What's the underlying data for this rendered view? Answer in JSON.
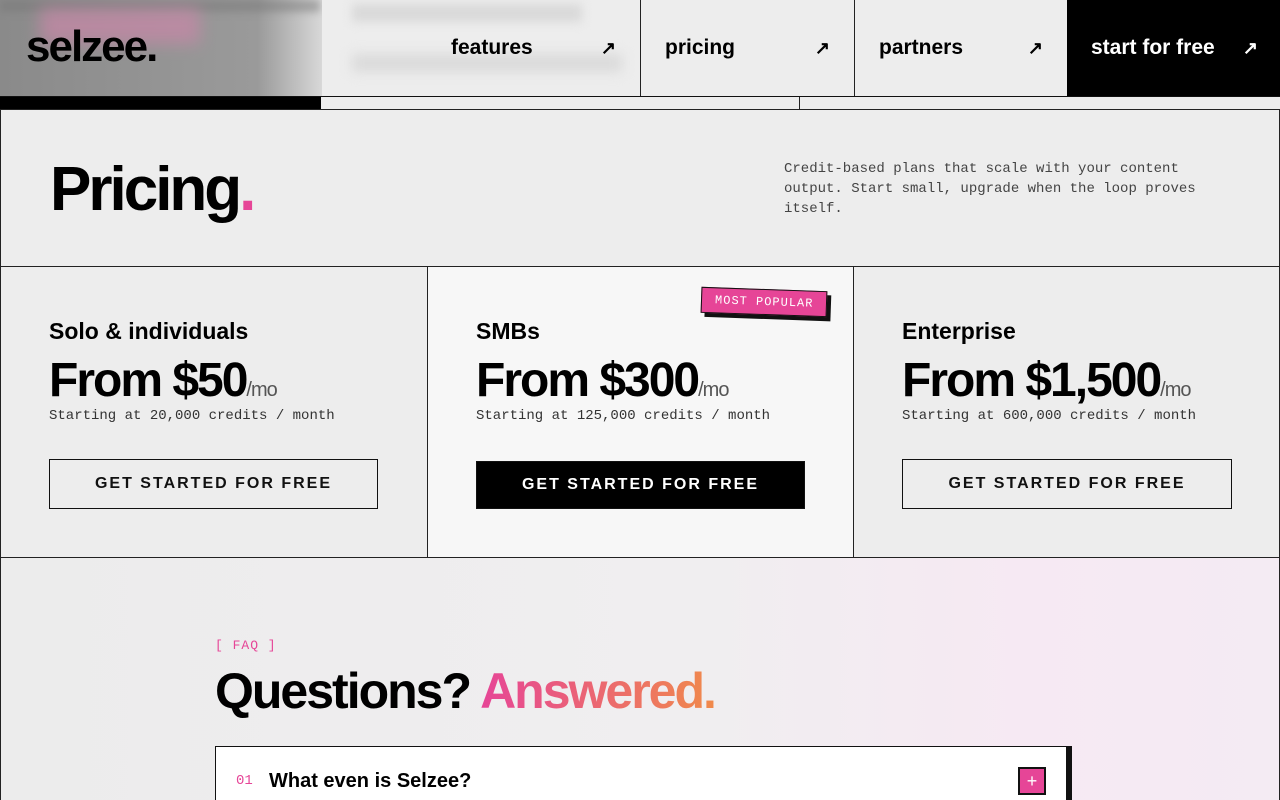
{
  "nav": {
    "logo": "selzee.",
    "items": [
      {
        "label": "features",
        "icon": "arrow-up-right-icon"
      },
      {
        "label": "pricing",
        "icon": "arrow-up-right-icon"
      },
      {
        "label": "partners",
        "icon": "arrow-up-right-icon"
      }
    ],
    "cta": "start for free"
  },
  "pricing": {
    "title": "Pricing",
    "title_dot": ".",
    "description": "Credit-based plans that scale with your content output. Start small, upgrade when the loop proves itself."
  },
  "badge": "MOST POPULAR",
  "plans": [
    {
      "name": "Solo & individuals",
      "price": "From $50",
      "unit": "/mo",
      "credits": "Starting at 20,000 credits / month",
      "button": "GET STARTED FOR FREE"
    },
    {
      "name": "SMBs",
      "price": "From $300",
      "unit": "/mo",
      "credits": "Starting at 125,000 credits / month",
      "button": "GET STARTED FOR FREE"
    },
    {
      "name": "Enterprise",
      "price": "From $1,500",
      "unit": "/mo",
      "credits": "Starting at 600,000 credits / month",
      "button": "GET STARTED FOR FREE"
    }
  ],
  "faq": {
    "tag": "[ FAQ ]",
    "title_main": "Questions? ",
    "title_accent": "Answered.",
    "items": [
      {
        "num": "01",
        "question": "What even is Selzee?",
        "toggle": "+"
      }
    ]
  },
  "colors": {
    "accent": "#e64597",
    "accent_orange": "#f08a4b",
    "cta_bg": "#000000",
    "page_bg": "#ededed"
  }
}
